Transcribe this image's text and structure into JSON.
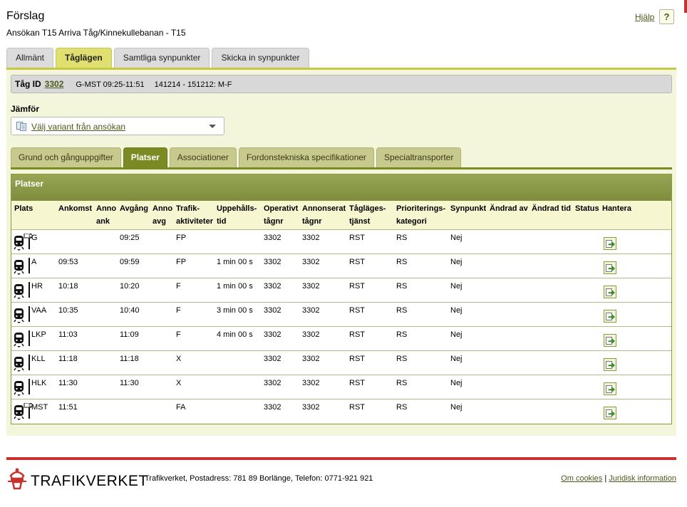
{
  "header": {
    "title": "Förslag",
    "subtitle": "Ansökan T15 Arriva Tåg/Kinnekullebanan - T15",
    "help_label": "Hjälp",
    "help_button": "?"
  },
  "main_tabs": [
    {
      "label": "Allmänt",
      "active": false
    },
    {
      "label": "Tåglägen",
      "active": true
    },
    {
      "label": "Samtliga synpunkter",
      "active": false
    },
    {
      "label": "Skicka in synpunkter",
      "active": false
    }
  ],
  "train": {
    "label": "Tåg ID",
    "id": "3302",
    "route": "G-MST 09:25-11:51",
    "period": "141214 - 151212: M-F"
  },
  "compare": {
    "label": "Jämför",
    "select_text": "Välj variant från ansökan",
    "icon": "document-compare-icon"
  },
  "sub_tabs": [
    {
      "label": "Grund och gånguppgifter",
      "active": false
    },
    {
      "label": "Platser",
      "active": true
    },
    {
      "label": "Associationer",
      "active": false
    },
    {
      "label": "Fordonstekniska specifikationer",
      "active": false
    },
    {
      "label": "Specialtransporter",
      "active": false
    }
  ],
  "table": {
    "title": "Platser",
    "headers": {
      "plats": "Plats",
      "ankomst": "Ankomst",
      "anno_ank_1": "Anno",
      "anno_ank_2": "ank",
      "avgang": "Avgång",
      "anno_avg_1": "Anno",
      "anno_avg_2": "avg",
      "trafik_1": "Trafik-",
      "trafik_2": "aktiviteter",
      "uppehall_1": "Uppehålls-",
      "uppehall_2": "tid",
      "operativt_1": "Operativt",
      "operativt_2": "tågnr",
      "annonserat_1": "Annonserat",
      "annonserat_2": "tågnr",
      "taglages_1": "Tågläges-",
      "taglages_2": "tjänst",
      "prio_1": "Prioriterings-",
      "prio_2": "kategori",
      "synpunkt": "Synpunkt",
      "andrad_av": "Ändrad av",
      "andrad_tid": "Ändrad tid",
      "status": "Status",
      "hantera": "Hantera"
    },
    "rows": [
      {
        "plats": "G",
        "ankomst": "",
        "avgang": "09:25",
        "trafik": "FP",
        "uppehall": "",
        "operativt": "3302",
        "annonserat": "3302",
        "taglage": "RST",
        "prio": "RS",
        "synpunkt": "Nej",
        "icon": "train-station-end-icon"
      },
      {
        "plats": "A",
        "ankomst": "09:53",
        "avgang": "09:59",
        "trafik": "FP",
        "uppehall": "1 min 00 s",
        "operativt": "3302",
        "annonserat": "3302",
        "taglage": "RST",
        "prio": "RS",
        "synpunkt": "Nej",
        "icon": "train-icon"
      },
      {
        "plats": "HR",
        "ankomst": "10:18",
        "avgang": "10:20",
        "trafik": "F",
        "uppehall": "1 min 00 s",
        "operativt": "3302",
        "annonserat": "3302",
        "taglage": "RST",
        "prio": "RS",
        "synpunkt": "Nej",
        "icon": "train-icon"
      },
      {
        "plats": "VAA",
        "ankomst": "10:35",
        "avgang": "10:40",
        "trafik": "F",
        "uppehall": "3 min 00 s",
        "operativt": "3302",
        "annonserat": "3302",
        "taglage": "RST",
        "prio": "RS",
        "synpunkt": "Nej",
        "icon": "train-icon"
      },
      {
        "plats": "LKP",
        "ankomst": "11:03",
        "avgang": "11:09",
        "trafik": "F",
        "uppehall": "4 min 00 s",
        "operativt": "3302",
        "annonserat": "3302",
        "taglage": "RST",
        "prio": "RS",
        "synpunkt": "Nej",
        "icon": "train-icon"
      },
      {
        "plats": "KLL",
        "ankomst": "11:18",
        "avgang": "11:18",
        "trafik": "X",
        "uppehall": "",
        "operativt": "3302",
        "annonserat": "3302",
        "taglage": "RST",
        "prio": "RS",
        "synpunkt": "Nej",
        "icon": "train-icon"
      },
      {
        "plats": "HLK",
        "ankomst": "11:30",
        "avgang": "11:30",
        "trafik": "X",
        "uppehall": "",
        "operativt": "3302",
        "annonserat": "3302",
        "taglage": "RST",
        "prio": "RS",
        "synpunkt": "Nej",
        "icon": "train-icon"
      },
      {
        "plats": "MST",
        "ankomst": "11:51",
        "avgang": "",
        "trafik": "FA",
        "uppehall": "",
        "operativt": "3302",
        "annonserat": "3302",
        "taglage": "RST",
        "prio": "RS",
        "synpunkt": "Nej",
        "icon": "train-station-end-icon"
      }
    ]
  },
  "footer": {
    "logo_text": "TRAFIKVERKET",
    "info": "Trafikverket, Postadress: 781 89 Borlänge, Telefon: 0771-921 921",
    "link_cookies": "Om cookies",
    "separator": "|",
    "link_legal": "Juridisk information"
  },
  "colors": {
    "accent_green": "#c6ca3f",
    "dark_green": "#7b8a22",
    "panel_bg": "#f4f6dc",
    "brand_red": "#c9312b"
  }
}
